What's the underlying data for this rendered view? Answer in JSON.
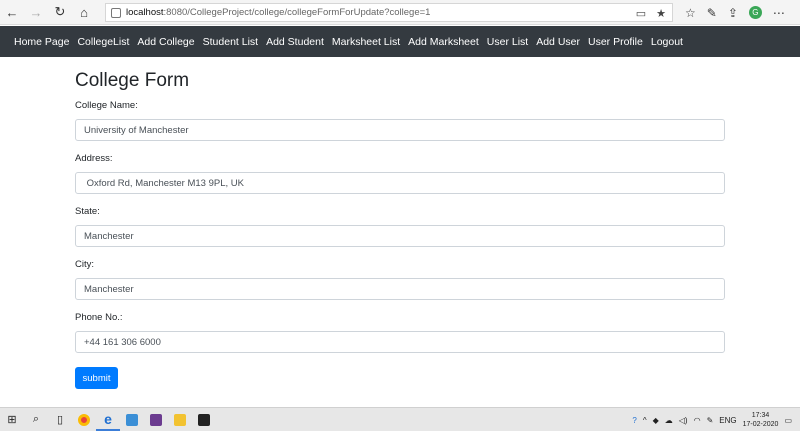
{
  "browser": {
    "url_host": "localhost",
    "url_path": ":8080/CollegeProject/college/collegeFormForUpdate?college=1",
    "profile_initial": "G",
    "nav": {
      "back": "←",
      "forward": "→",
      "refresh": "↻",
      "home": "⌂"
    },
    "tools": [
      "☆",
      "✎",
      "⇪",
      "⋯"
    ]
  },
  "app_nav": {
    "items": [
      "Home Page",
      "CollegeList",
      "Add College",
      "Student List",
      "Add Student",
      "Marksheet List",
      "Add Marksheet",
      "User List",
      "Add User",
      "User Profile",
      "Logout"
    ]
  },
  "form": {
    "title": "College Form",
    "fields": [
      {
        "label": "College Name:",
        "value": "University of Manchester"
      },
      {
        "label": "Address:",
        "value": " Oxford Rd, Manchester M13 9PL, UK"
      },
      {
        "label": "State:",
        "value": "Manchester"
      },
      {
        "label": "City:",
        "value": "Manchester"
      },
      {
        "label": "Phone No.:",
        "value": "+44 161 306 6000"
      }
    ],
    "submit_label": "submit"
  },
  "taskbar": {
    "tray_language": "ENG",
    "time": "17:34",
    "date": "17-02-2020"
  }
}
